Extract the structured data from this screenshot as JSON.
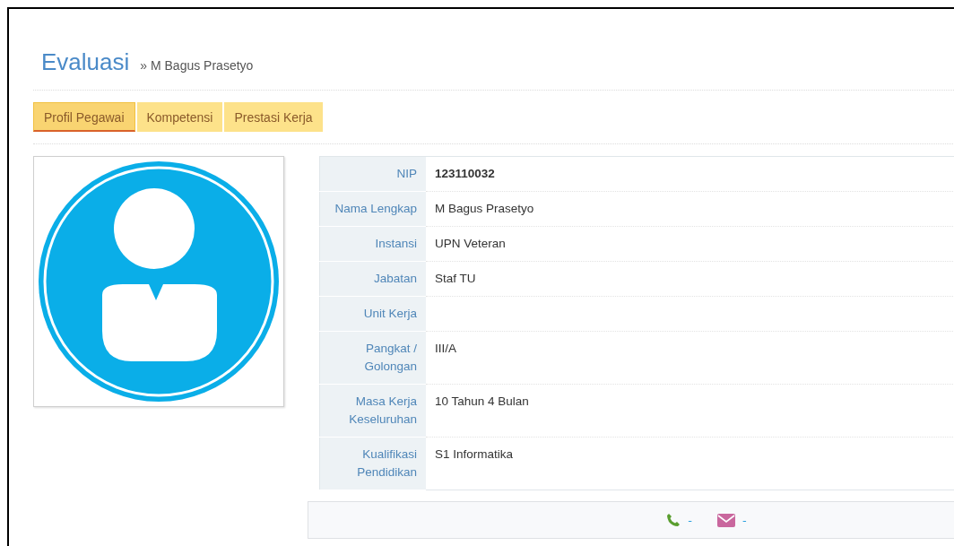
{
  "header": {
    "title": "Evaluasi",
    "breadcrumb": "» M Bagus Prasetyo"
  },
  "tabs": [
    {
      "label": "Profil Pegawai",
      "selected": true
    },
    {
      "label": "Kompetensi",
      "selected": false
    },
    {
      "label": "Prestasi Kerja",
      "selected": false
    }
  ],
  "profile": {
    "rows": [
      {
        "label": "NIP",
        "value": "123110032",
        "bold": true
      },
      {
        "label": "Nama Lengkap",
        "value": "M Bagus Prasetyo",
        "bold": false
      },
      {
        "label": "Instansi",
        "value": "UPN Veteran",
        "bold": false
      },
      {
        "label": "Jabatan",
        "value": "Staf TU",
        "bold": false
      },
      {
        "label": "Unit Kerja"
      },
      {
        "label": "Pangkat / Golongan",
        "value": "III/A",
        "bold": false
      },
      {
        "label": "Masa Kerja Keseluruhan",
        "value": "10 Tahun 4 Bulan",
        "bold": false
      },
      {
        "label": "Kualifikasi Pendidikan",
        "value": "S1 Informatika",
        "bold": false
      }
    ]
  },
  "contact": {
    "phone": "-",
    "email": "-"
  }
}
